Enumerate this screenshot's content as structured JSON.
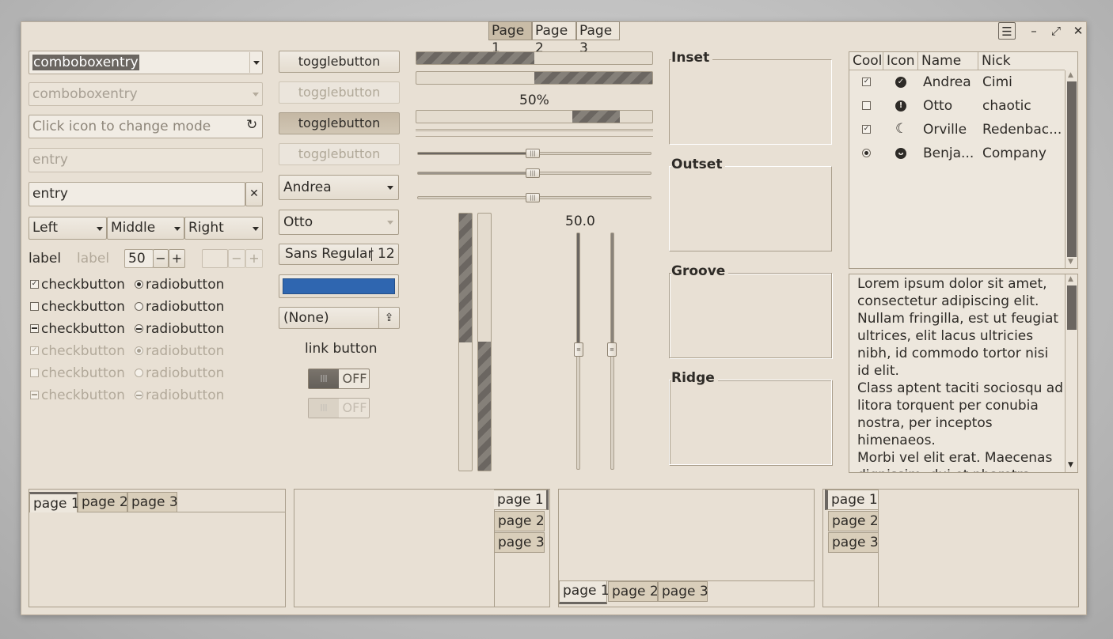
{
  "header": {
    "stack_switcher": [
      "Page 1",
      "Page 2",
      "Page 3"
    ],
    "icons": [
      "menu-icon",
      "minimize-icon",
      "maximize-icon",
      "close-icon"
    ]
  },
  "col1": {
    "combo_entry_1": "comboboxentry",
    "combo_entry_2": "comboboxentry",
    "mode_entry_placeholder": "Click icon to change mode",
    "entry_disabled": "entry",
    "entry_clear": "entry",
    "combos": [
      "Left",
      "Middle",
      "Right"
    ],
    "label": "label",
    "label_disabled": "label",
    "spin_value": "50",
    "checks": [
      {
        "check": "checkbutton",
        "radio": "radiobutton",
        "state": "checked"
      },
      {
        "check": "checkbutton",
        "radio": "radiobutton",
        "state": "unchecked"
      },
      {
        "check": "checkbutton",
        "radio": "radiobutton",
        "state": "mixed"
      },
      {
        "check": "checkbutton",
        "radio": "radiobutton",
        "state": "checked-disabled"
      },
      {
        "check": "checkbutton",
        "radio": "radiobutton",
        "state": "unchecked-disabled"
      },
      {
        "check": "checkbutton",
        "radio": "radiobutton",
        "state": "mixed-disabled"
      }
    ]
  },
  "col2": {
    "toggles": [
      "togglebutton",
      "togglebutton",
      "togglebutton",
      "togglebutton"
    ],
    "combo_andrea": "Andrea",
    "combo_otto": "Otto",
    "font_name": "Sans Regular",
    "font_size": "12",
    "color_value": "#2f66b0",
    "file_chooser": "(None)",
    "link": "link button",
    "switch_1": "OFF",
    "switch_2": "OFF"
  },
  "col3": {
    "progress_1": 0.5,
    "progress_2": 0.5,
    "progress_label": "50%",
    "scale_value": "50.0"
  },
  "frames": [
    "Inset",
    "Outset",
    "Groove",
    "Ridge"
  ],
  "tree": {
    "columns": [
      "Cool",
      "Icon",
      "Name",
      "Nick"
    ],
    "rows": [
      {
        "cool": "check",
        "icon": "check-circle-icon",
        "name": "Andrea",
        "nick": "Cimi"
      },
      {
        "cool": "unchecked",
        "icon": "warning-icon",
        "name": "Otto",
        "nick": "chaotic"
      },
      {
        "cool": "check",
        "icon": "moon-icon",
        "name": "Orville",
        "nick": "Redenbac..."
      },
      {
        "cool": "radio",
        "icon": "monkey-icon",
        "name": "Benja...",
        "nick": "Company"
      }
    ]
  },
  "textview": {
    "lines": [
      "Lorem ipsum dolor sit amet,",
      "consectetur adipiscing elit.",
      "Nullam fringilla, est ut feugiat",
      "ultrices, elit lacus ultricies",
      "nibh, id commodo tortor nisi",
      "id elit.",
      "Class aptent taciti sociosqu ad",
      "litora torquent per conubia",
      "nostra, per inceptos",
      "himenaeos.",
      "Morbi vel elit erat. Maecenas",
      "dignissim, dui et pharetra"
    ]
  },
  "notebooks": {
    "tabs": [
      "page 1",
      "page 2",
      "page 3"
    ]
  },
  "colors": {
    "accent": "#2f66b0",
    "window": "#e8e0d4",
    "dark": "#6b6661"
  }
}
